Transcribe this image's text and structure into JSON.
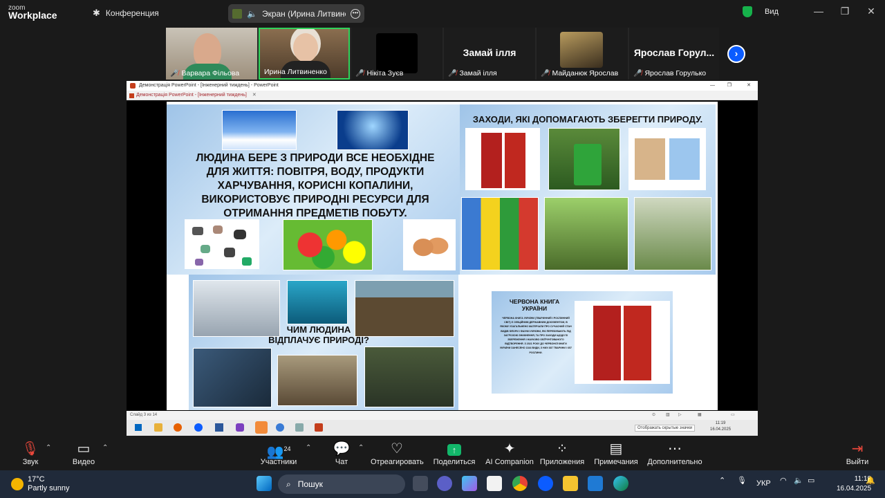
{
  "titlebar": {
    "brand_top": "zoom",
    "brand_bottom": "Workplace",
    "meeting_label": "Конференция",
    "share_label": "Экран (Ирина Литвиненко",
    "view_label": "Вид"
  },
  "participants": [
    {
      "name": "Варвара Фільова",
      "muted": true,
      "video": true
    },
    {
      "name": "Ирина Литвиненко",
      "muted": false,
      "video": true,
      "speaking": true
    },
    {
      "name": "Нікіта Зуєв",
      "muted": true,
      "video": false
    },
    {
      "name": "Замай ілля",
      "display": "Замай ілля",
      "muted": true,
      "video": false
    },
    {
      "name": "Майданюк Ярослав",
      "muted": true,
      "video": true
    },
    {
      "name": "Ярослав Горулько",
      "display": "Ярослав Горул...",
      "muted": true,
      "video": false
    }
  ],
  "ppt": {
    "window_title": "Демонстрація PowerPoint - [Інженерний тиждень] - PowerPoint",
    "tab_title": "Демонстрація PowerPoint - [Інженерний тиждень]",
    "status": "Слайд 3 из 14",
    "tooltip": "Отображать скрытые значки",
    "inner_time": "11:19",
    "inner_date": "16.04.2025"
  },
  "slide": {
    "heading_right": "ЗАХОДИ, ЯКІ ДОПОМАГАЮТЬ ЗБЕРЕГТИ ПРИРОДУ.",
    "main_text": "ЛЮДИНА БЕРЕ З ПРИРОДИ ВСЕ НЕОБХІДНЕ ДЛЯ  ЖИТТЯ: ПОВІТРЯ, ВОДУ, ПРОДУКТИ ХАРЧУВАННЯ, КОРИСНІ КОПАЛИНИ, ВИКОРИСТОВУЄ ПРИРОДНІ РЕСУРСИ ДЛЯ ОТРИМАННЯ ПРЕДМЕТІВ ПОБУТУ.",
    "question": "ЧИМ ЛЮДИНА ВІДПЛАЧУЄ ПРИРОДІ?",
    "red_book_title": "ЧЕРВОНА КНИГА УКРАЇНИ",
    "red_book_text": "ЧЕРВОНА КНИГА УКРАЇНИ (ТВАРИННИЙ І РОСЛИННИЙ СВІТ) Є ОФІЦІЙНИМ ДЕРЖАВНИМ ДОКУМЕНТОМ, В ЯКОМУ УЗАГАЛЬНЕНО МАТЕРІАЛИ ПРО СУЧАСНИЙ СТАН ВИДІВ ФЛОРИ І ФАУНИ УКРАЇНИ, ЯКІ ПЕРЕБУВАЮТЬ ПІД ЗАГРОЗОЮ ЗНИКНЕННЯ, ТА ПРО ЗАХОДИ ЩОДО ЇХ ЗБЕРЕЖЕННЯ І НАУКОВО ОБҐРУНТОВАНОГО ВІДТВОРЕННЯ. З 2021 РОКУ ДО ЧЕРВОНОЇ КНИГИ УКРАЇНИ ЗАНЕСЕНО 1344 ВИДИ, З НИХ 687 ТВАРИНИ І 657 РОСЛИНИ."
  },
  "toolbar": {
    "audio": "Звук",
    "video": "Видео",
    "participants": "Участники",
    "participants_count": "24",
    "chat": "Чат",
    "react": "Отреагировать",
    "share": "Поделиться",
    "ai": "AI Companion",
    "apps": "Приложения",
    "notes": "Примечания",
    "more": "Дополнительно",
    "leave": "Выйти"
  },
  "taskbar": {
    "temp": "17°C",
    "weather": "Partly sunny",
    "search": "Пошук",
    "lang": "УКР",
    "time": "11:19",
    "date": "16.04.2025"
  },
  "colors": {
    "zoom_blue": "#0b5cff",
    "share_green": "#12b76a",
    "active_speaker": "#2fd35b",
    "muted_red": "#e8473b"
  }
}
